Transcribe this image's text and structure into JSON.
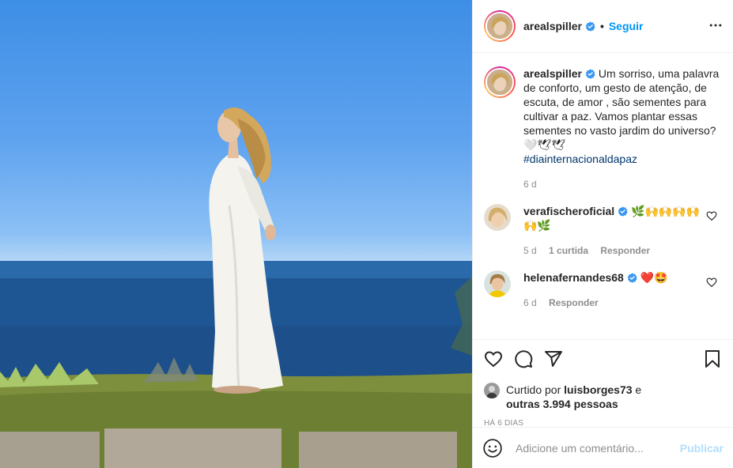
{
  "post": {
    "username": "arealspiller",
    "separator": "•",
    "follow_label": "Seguir",
    "caption": {
      "username": "arealspiller",
      "text": "Um sorriso, uma palavra de conforto, um gesto de atenção, de escuta, de amor , são sementes para cultivar a paz. Vamos plantar essas sementes no vasto jardim do universo? 🤍🕊🕊",
      "hashtag": "#diainternacionaldapaz",
      "time": "6 d"
    },
    "comments": [
      {
        "username": "verafischeroficial",
        "text": "🌿🙌🙌🙌🙌🙌🌿",
        "time": "5 d",
        "likes": "1 curtida",
        "reply": "Responder"
      },
      {
        "username": "helenafernandes68",
        "text": "❤️🤩",
        "time": "6 d",
        "reply": "Responder"
      }
    ],
    "liked_by_prefix": "Curtido por",
    "liked_by_user": "luisborges73",
    "liked_by_and": "e",
    "liked_by_others": "outras 3.994 pessoas",
    "posted_ago": "HÁ 6 DIAS",
    "comment_placeholder": "Adicione um comentário...",
    "publish_label": "Publicar"
  },
  "colors": {
    "accent": "#0095f6",
    "publish_disabled": "#b2dffc",
    "muted": "#8e8e8e",
    "text": "#262626",
    "verified": "#3897f0"
  },
  "icons": [
    "more-icon",
    "verified-icon",
    "heart-icon",
    "comment-icon",
    "share-icon",
    "bookmark-icon",
    "emoji-icon"
  ]
}
